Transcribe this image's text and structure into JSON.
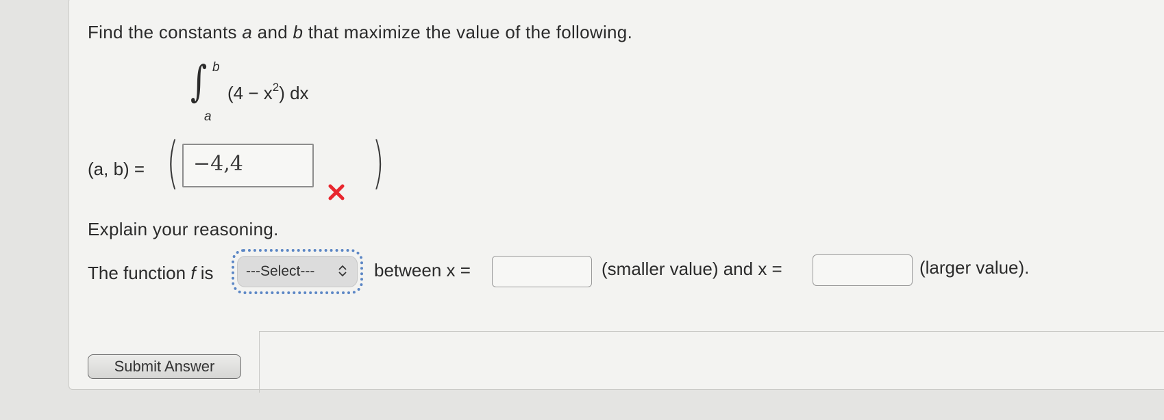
{
  "question": {
    "prompt_parts": [
      "Find the constants ",
      "a",
      " and ",
      "b",
      " that maximize the value of the following."
    ],
    "integral": {
      "upper_limit": "b",
      "lower_limit": "a",
      "integrand_open": "(4 − x",
      "integrand_exp": "2",
      "integrand_close": ") dx"
    },
    "ab_label": "(a, b) =",
    "ab_input_value": "−4,4",
    "ab_status": "incorrect"
  },
  "explanation": {
    "heading": "Explain your reasoning.",
    "sentence_start": "The function ",
    "sentence_var": "f",
    "sentence_is": " is",
    "select_value": "---Select---",
    "between_text": "between x =",
    "smaller_text": "(smaller value) and x =",
    "larger_text": "(larger value).",
    "x_smaller_value": "",
    "x_larger_value": ""
  },
  "actions": {
    "submit_label": "Submit Answer"
  },
  "colors": {
    "wrong_mark": "#e8262e",
    "focus_ring": "#5b86c5"
  },
  "icons": [
    "incorrect-x-icon",
    "select-chevron-icon"
  ]
}
